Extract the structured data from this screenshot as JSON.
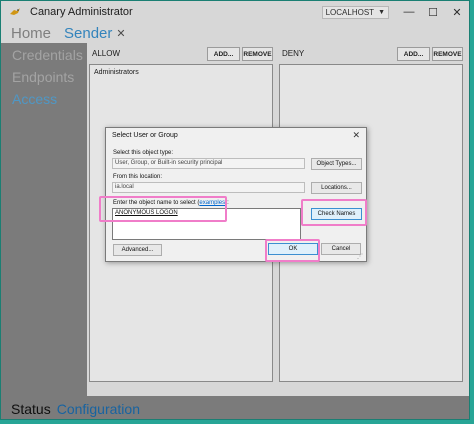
{
  "app": {
    "title": "Canary Administrator",
    "host": "LOCALHOST",
    "minimize": "—",
    "maximize": "☐",
    "close": "✕"
  },
  "nav": {
    "home": "Home",
    "sender": "Sender",
    "close": "✕"
  },
  "sidebar": {
    "items": [
      "Credentials",
      "Endpoints",
      "Access"
    ],
    "active": "Access"
  },
  "allow": {
    "label": "ALLOW",
    "add": "ADD...",
    "remove": "REMOVE",
    "items": [
      "Administrators"
    ]
  },
  "deny": {
    "label": "DENY",
    "add": "ADD...",
    "remove": "REMOVE"
  },
  "status": {
    "status": "Status",
    "configuration": "Configuration"
  },
  "dialog": {
    "title": "Select User or Group",
    "close": "✕",
    "object_type_label": "Select this object type:",
    "object_type_value": "User, Group, or Built-in security principal",
    "object_types_btn": "Object Types...",
    "location_label": "From this location:",
    "location_value": "ia.local",
    "locations_btn": "Locations...",
    "enter_label_prefix": "Enter the object name to select (",
    "enter_label_link": "examples",
    "enter_label_suffix": "):",
    "object_name": "ANONYMOUS LOGON",
    "check_names_btn": "Check Names",
    "advanced_btn": "Advanced...",
    "ok_btn": "OK",
    "cancel_btn": "Cancel"
  },
  "colors": {
    "accent": "#3a94d2",
    "highlight": "#f07dc9",
    "sidebar": "#8a8a8a",
    "desktop": "#2cb8a8"
  }
}
